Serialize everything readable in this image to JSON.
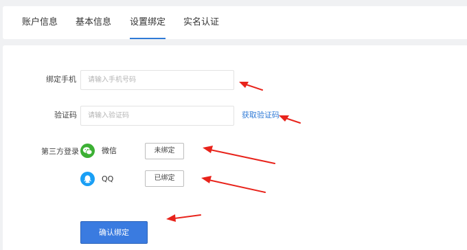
{
  "tabs": [
    {
      "label": "账户信息",
      "active": false
    },
    {
      "label": "基本信息",
      "active": false
    },
    {
      "label": "设置绑定",
      "active": true
    },
    {
      "label": "实名认证",
      "active": false
    }
  ],
  "form": {
    "phone": {
      "label": "绑定手机",
      "placeholder": "请输入手机号码",
      "value": ""
    },
    "code": {
      "label": "验证码",
      "placeholder": "请输入验证码",
      "value": "",
      "get_code_label": "获取验证码"
    },
    "third_party": {
      "label": "第三方登录",
      "accounts": [
        {
          "name": "微信",
          "icon": "wechat-icon",
          "color": "#3cb034",
          "button_label": "未绑定"
        },
        {
          "name": "QQ",
          "icon": "qq-icon",
          "color": "#1a9ff5",
          "button_label": "已绑定"
        }
      ]
    },
    "confirm_label": "确认绑定"
  },
  "colors": {
    "accent": "#2f7ad6",
    "annotation": "#e8231b"
  }
}
